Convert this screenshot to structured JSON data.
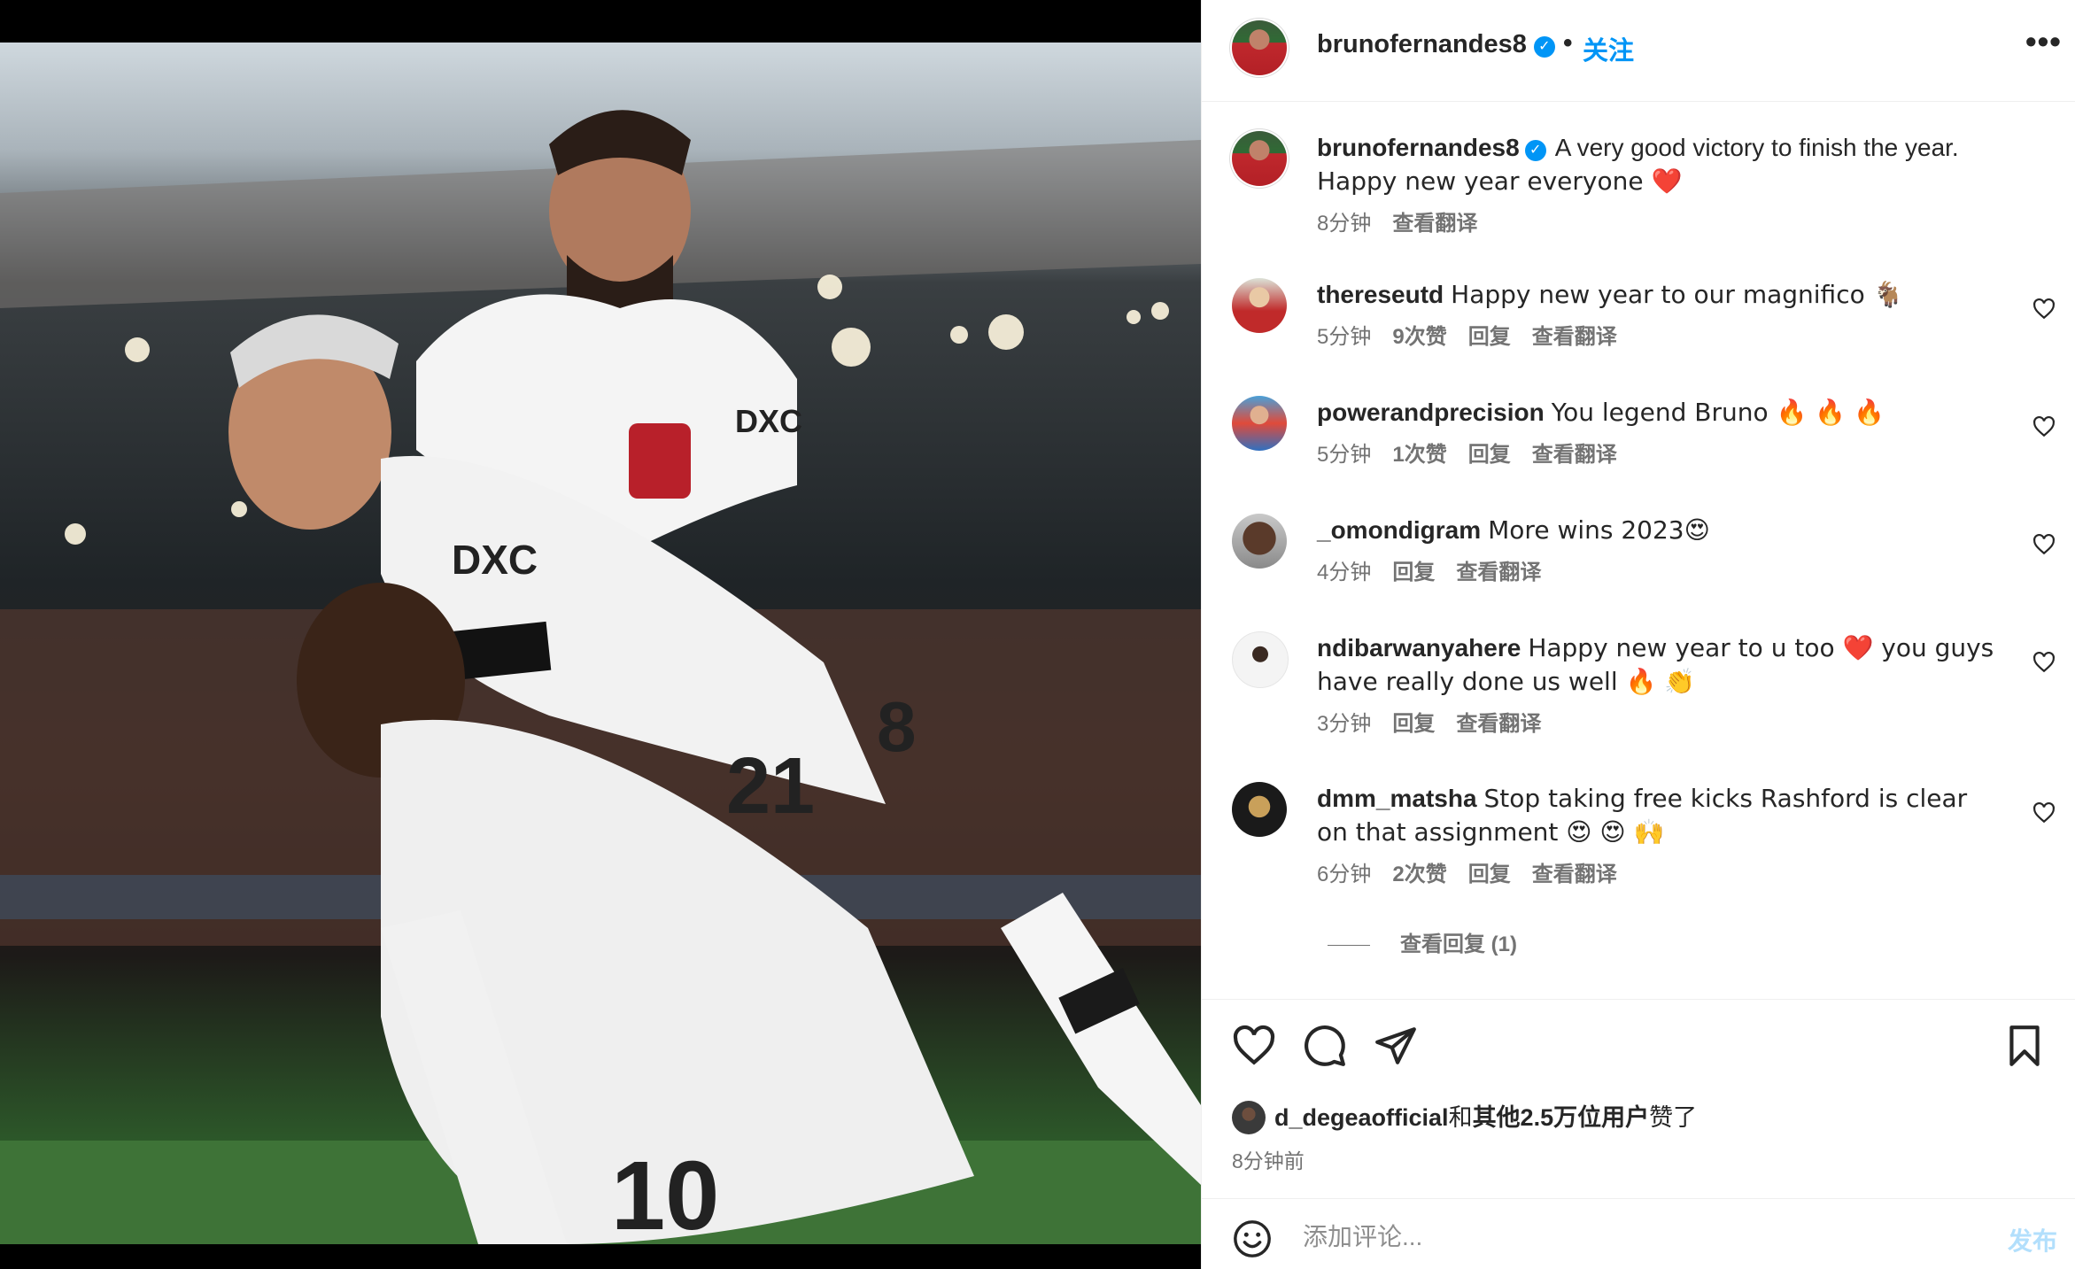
{
  "post": {
    "username": "brunofernandes8",
    "verified_mark": "✓",
    "dot": "•",
    "follow_label": "关注",
    "more_label": "•••"
  },
  "caption": {
    "username": "brunofernandes8",
    "line1": "A very good victory to finish the year.",
    "line2": "Happy new year everyone ❤️",
    "time": "8分钟",
    "translate": "查看翻译"
  },
  "comments": [
    {
      "username": "thereseutd",
      "text": "Happy new year to our magnifico 🐐",
      "time": "5分钟",
      "likes": "9次赞",
      "reply": "回复",
      "translate": "查看翻译"
    },
    {
      "username": "powerandprecision",
      "text": "You legend Bruno 🔥 🔥 🔥",
      "time": "5分钟",
      "likes": "1次赞",
      "reply": "回复",
      "translate": "查看翻译"
    },
    {
      "username": "_omondigram",
      "text": "More wins 2023😍",
      "time": "4分钟",
      "likes": "",
      "reply": "回复",
      "translate": "查看翻译"
    },
    {
      "username": "ndibarwanyahere",
      "text": "Happy new year to u too ❤️ you guys have really done us well 🔥 👏",
      "time": "3分钟",
      "likes": "",
      "reply": "回复",
      "translate": "查看翻译"
    },
    {
      "username": "dmm_matsha",
      "text": "Stop taking free kicks Rashford is clear on that assignment 😍 😍 🙌",
      "time": "6分钟",
      "likes": "2次赞",
      "reply": "回复",
      "translate": "查看翻译"
    }
  ],
  "view_replies": "查看回复 (1)",
  "likes": {
    "user": "d_degeaofficial",
    "joiner": "和",
    "others": "其他2.5万位用户",
    "suffix": "赞了"
  },
  "posted_time": "8分钟前",
  "add_comment": {
    "placeholder": "添加评论...",
    "post_label": "发布"
  },
  "icons": [
    "verified-badge-icon",
    "more-icon",
    "heart-icon",
    "comment-icon",
    "share-icon",
    "bookmark-icon",
    "emoji-icon"
  ],
  "colors": {
    "accent": "#0095f6",
    "post_disabled": "#b2dffc",
    "meta": "#737373",
    "text": "#262626"
  }
}
